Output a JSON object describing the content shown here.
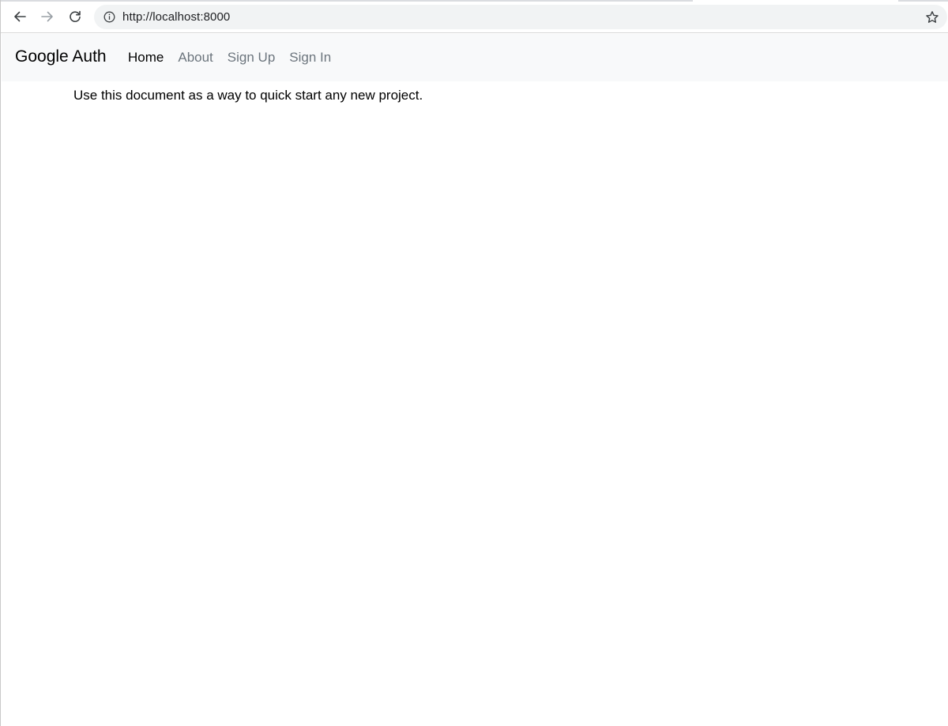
{
  "browser": {
    "url": "http://localhost:8000",
    "icons": {
      "back": "arrow-left-icon",
      "forward": "arrow-right-icon",
      "reload": "reload-icon",
      "info": "info-icon",
      "bookmark": "star-icon"
    }
  },
  "navbar": {
    "brand": "Google Auth",
    "links": [
      {
        "label": "Home",
        "active": true
      },
      {
        "label": "About",
        "active": false
      },
      {
        "label": "Sign Up",
        "active": false
      },
      {
        "label": "Sign In",
        "active": false
      }
    ]
  },
  "main": {
    "text": "Use this document as a way to quick start any new project."
  },
  "colors": {
    "navbar_bg": "#f8f9fa",
    "link_muted": "#6c757d",
    "link_active": "#000000",
    "omnibox_bg": "#f1f3f4"
  }
}
